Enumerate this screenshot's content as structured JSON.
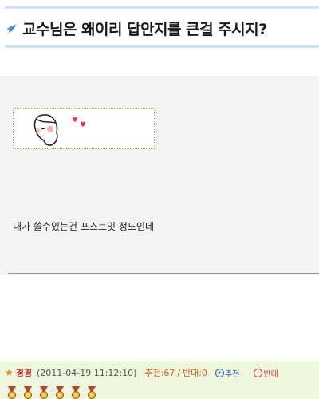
{
  "post": {
    "title": "교수님은 왜이리 답안지를 큰걸 주시지?",
    "body": "내가 쓸수있는건 포스트잇 정도인데"
  },
  "comment": {
    "author": "경경",
    "timestamp": "(2011-04-19 11:12:10)",
    "recommend_label": "추천:67",
    "separator": "/",
    "oppose_label": "반대:0",
    "recommend_button": "추천",
    "oppose_button": "반대",
    "medal_count": 6
  },
  "colors": {
    "title_line": "#cfe2f5",
    "content_bg": "#f3f3f3",
    "comment_bg": "#eef6dd",
    "author": "#c62b2b",
    "votes": "#e05a1a"
  },
  "icons": {
    "title_icon": "bird-icon",
    "star": "star-icon",
    "medal": "medal-icon"
  }
}
